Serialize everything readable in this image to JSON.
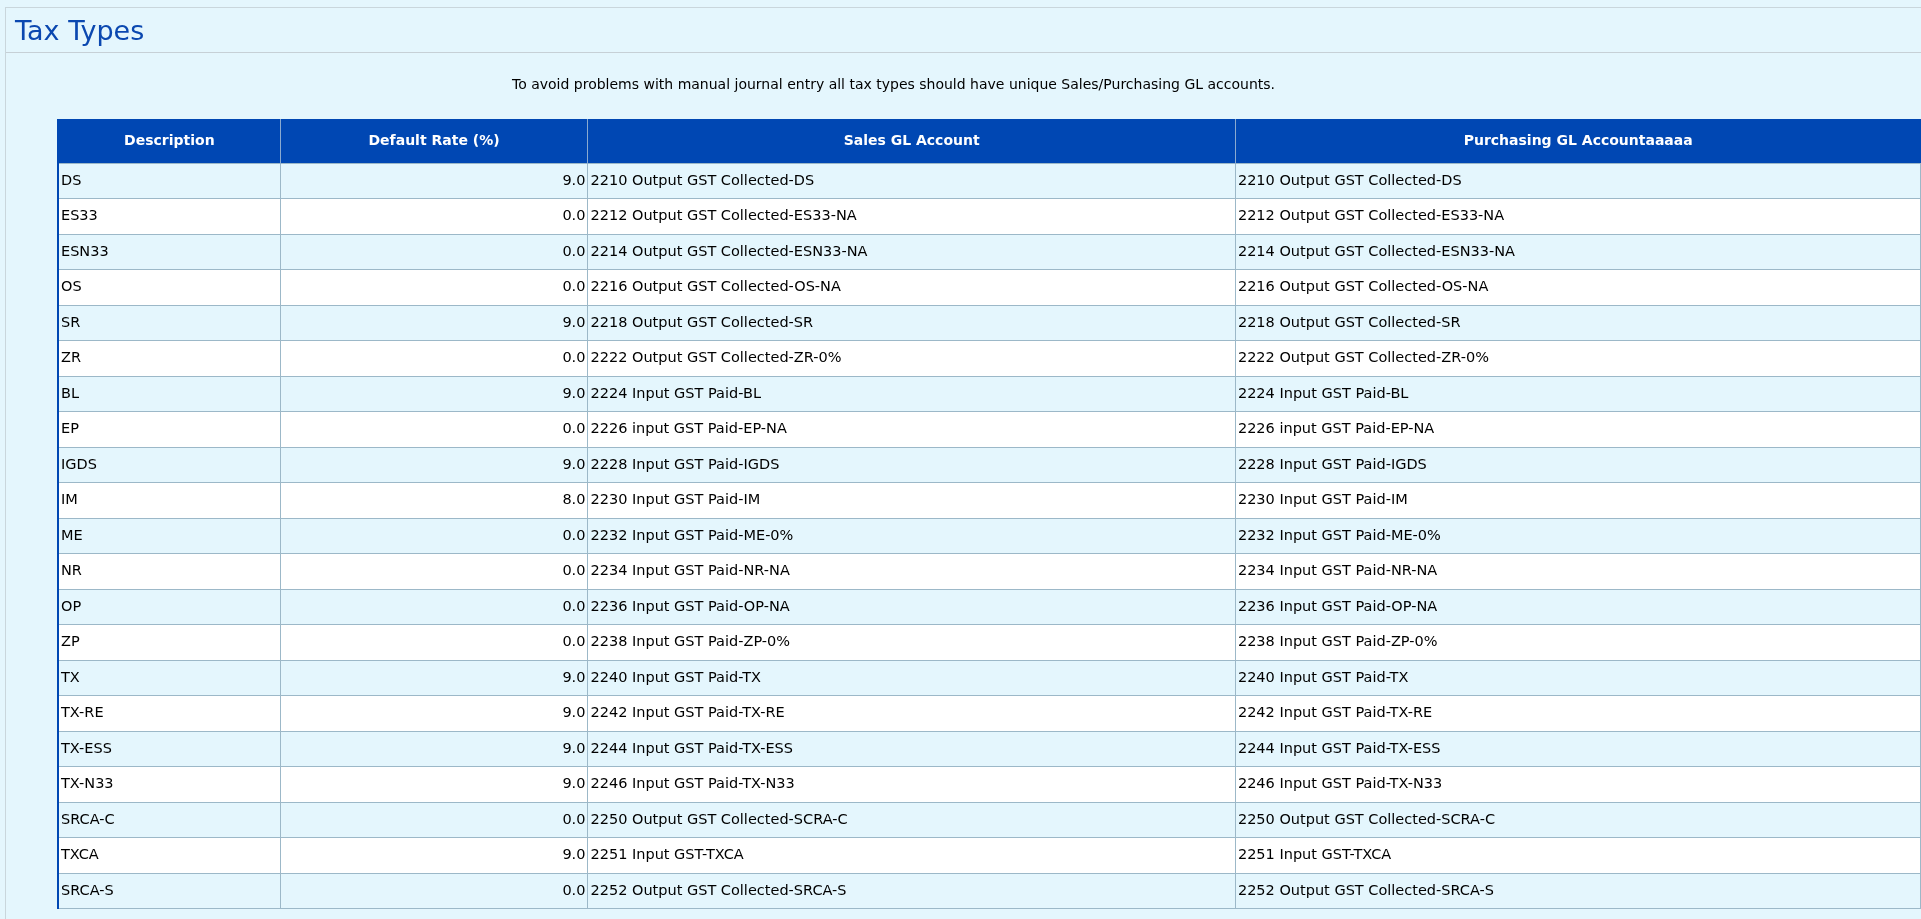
{
  "title": "Tax Types",
  "notice": "To avoid problems with manual journal entry all tax types should have unique Sales/Purchasing GL accounts.",
  "table": {
    "columns": [
      "Description",
      "Default Rate (%)",
      "Sales GL Account",
      "Purchasing GL Accountaaaaa"
    ],
    "rows": [
      [
        "DS",
        "9.0",
        "2210 Output GST Collected-DS",
        "2210 Output GST Collected-DS"
      ],
      [
        "ES33",
        "0.0",
        "2212 Output GST Collected-ES33-NA",
        "2212 Output GST Collected-ES33-NA"
      ],
      [
        "ESN33",
        "0.0",
        "2214 Output GST Collected-ESN33-NA",
        "2214 Output GST Collected-ESN33-NA"
      ],
      [
        "OS",
        "0.0",
        "2216 Output GST Collected-OS-NA",
        "2216 Output GST Collected-OS-NA"
      ],
      [
        "SR",
        "9.0",
        "2218 Output GST Collected-SR",
        "2218 Output GST Collected-SR"
      ],
      [
        "ZR",
        "0.0",
        "2222 Output GST Collected-ZR-0%",
        "2222 Output GST Collected-ZR-0%"
      ],
      [
        "BL",
        "9.0",
        "2224 Input GST Paid-BL",
        "2224 Input GST Paid-BL"
      ],
      [
        "EP",
        "0.0",
        "2226 input GST Paid-EP-NA",
        "2226 input GST Paid-EP-NA"
      ],
      [
        "IGDS",
        "9.0",
        "2228 Input GST Paid-IGDS",
        "2228 Input GST Paid-IGDS"
      ],
      [
        "IM",
        "8.0",
        "2230 Input GST Paid-IM",
        "2230 Input GST Paid-IM"
      ],
      [
        "ME",
        "0.0",
        "2232 Input GST Paid-ME-0%",
        "2232 Input GST Paid-ME-0%"
      ],
      [
        "NR",
        "0.0",
        "2234 Input GST Paid-NR-NA",
        "2234 Input GST Paid-NR-NA"
      ],
      [
        "OP",
        "0.0",
        "2236 Input GST Paid-OP-NA",
        "2236 Input GST Paid-OP-NA"
      ],
      [
        "ZP",
        "0.0",
        "2238 Input GST Paid-ZP-0%",
        "2238 Input GST Paid-ZP-0%"
      ],
      [
        "TX",
        "9.0",
        "2240 Input GST Paid-TX",
        "2240 Input GST Paid-TX"
      ],
      [
        "TX-RE",
        "9.0",
        "2242 Input GST Paid-TX-RE",
        "2242 Input GST Paid-TX-RE"
      ],
      [
        "TX-ESS",
        "9.0",
        "2244 Input GST Paid-TX-ESS",
        "2244 Input GST Paid-TX-ESS"
      ],
      [
        "TX-N33",
        "9.0",
        "2246 Input GST Paid-TX-N33",
        "2246 Input GST Paid-TX-N33"
      ],
      [
        "SRCA-C",
        "0.0",
        "2250 Output GST Collected-SCRA-C",
        "2250 Output GST Collected-SCRA-C"
      ],
      [
        "TXCA",
        "9.0",
        "2251 Input GST-TXCA",
        "2251 Input GST-TXCA"
      ],
      [
        "SRCA-S",
        "0.0",
        "2252 Output GST Collected-SRCA-S",
        "2252 Output GST Collected-SRCA-S"
      ]
    ]
  }
}
